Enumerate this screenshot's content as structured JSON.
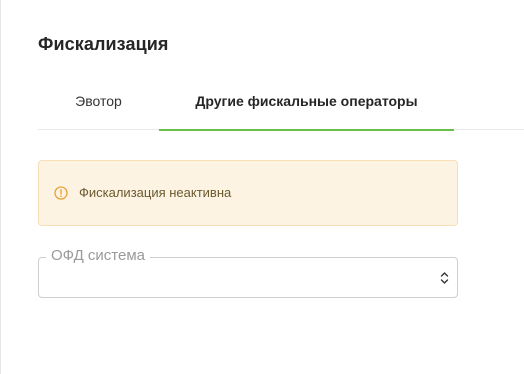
{
  "page": {
    "title": "Фискализация"
  },
  "tabs": [
    {
      "label": "Эвотор",
      "active": false
    },
    {
      "label": "Другие фискальные операторы",
      "active": true
    }
  ],
  "alert": {
    "icon": "info-circle-icon",
    "text": "Фискализация неактивна",
    "colors": {
      "background": "#fdf3e3",
      "border": "#f8dfb5",
      "icon": "#e9a23b"
    }
  },
  "ofd_field": {
    "label": "ОФД система",
    "value": "",
    "icon": "select-updown-icon"
  },
  "colors": {
    "accent": "#6abf4b"
  }
}
